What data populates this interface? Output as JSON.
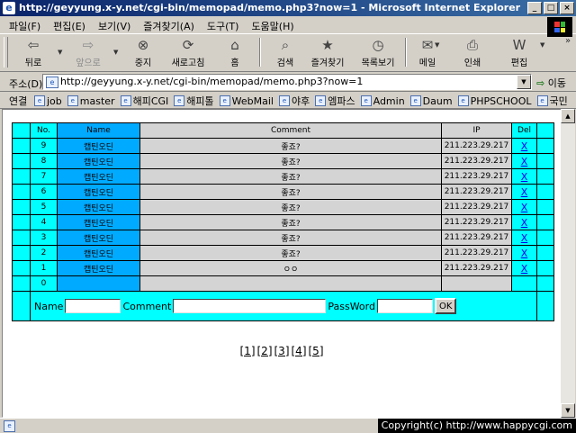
{
  "window": {
    "title": "http://geyyung.x-y.net/cgi-bin/memopad/memo.php3?now=1 - Microsoft Internet Explorer",
    "btn_min": "_",
    "btn_max": "□",
    "btn_close": "×"
  },
  "menu": [
    "파일(F)",
    "편집(E)",
    "보기(V)",
    "즐겨찾기(A)",
    "도구(T)",
    "도움말(H)"
  ],
  "toolbar": {
    "back": "뒤로",
    "forward": "앞으로",
    "stop": "중지",
    "refresh": "새로고침",
    "home": "홈",
    "search": "검색",
    "favorites": "즐겨찾기",
    "history": "목록보기",
    "mail": "메일",
    "print": "인쇄",
    "edit": "편집"
  },
  "address": {
    "label": "주소(D)",
    "url": "http://geyyung.x-y.net/cgi-bin/memopad/memo.php3?now=1",
    "go": "이동"
  },
  "links": {
    "label": "연결",
    "items": [
      "job",
      "master",
      "해피CGI",
      "해피톨",
      "WebMail",
      "야후",
      "엠파스",
      "Admin",
      "Daum",
      "PHPSCHOOL",
      "국민"
    ]
  },
  "memo": {
    "headers": {
      "no": "No.",
      "name": "Name",
      "comment": "Comment",
      "ip": "IP",
      "del": "Del"
    },
    "rows": [
      {
        "no": "9",
        "name": "캡틴오딘",
        "comment": "좋죠?",
        "ip": "211.223.29.217",
        "del": "X"
      },
      {
        "no": "8",
        "name": "캡틴오딘",
        "comment": "좋죠?",
        "ip": "211.223.29.217",
        "del": "X"
      },
      {
        "no": "7",
        "name": "캡틴오딘",
        "comment": "좋죠?",
        "ip": "211.223.29.217",
        "del": "X"
      },
      {
        "no": "6",
        "name": "캡틴오딘",
        "comment": "좋죠?",
        "ip": "211.223.29.217",
        "del": "X"
      },
      {
        "no": "5",
        "name": "캡틴오딘",
        "comment": "좋죠?",
        "ip": "211.223.29.217",
        "del": "X"
      },
      {
        "no": "4",
        "name": "캡틴오딘",
        "comment": "좋죠?",
        "ip": "211.223.29.217",
        "del": "X"
      },
      {
        "no": "3",
        "name": "캡틴오딘",
        "comment": "좋죠?",
        "ip": "211.223.29.217",
        "del": "X"
      },
      {
        "no": "2",
        "name": "캡틴오딘",
        "comment": "좋죠?",
        "ip": "211.223.29.217",
        "del": "X"
      },
      {
        "no": "1",
        "name": "캡틴오딘",
        "comment": "ㅇㅇ",
        "ip": "211.223.29.217",
        "del": "X"
      }
    ],
    "empty_row_no": "0",
    "form": {
      "name_label": "Name",
      "comment_label": "Comment",
      "password_label": "PassWord",
      "name_value": "",
      "comment_value": "",
      "password_value": "",
      "ok_label": "OK"
    }
  },
  "pager": [
    "[1]",
    "[2]",
    "[3]",
    "[4]",
    "[5]"
  ],
  "status": {
    "copyright": "Copyright(c) http://www.happycgi.com"
  },
  "colors": {
    "cyan": "#00ffff",
    "header_blue": "#00aaff",
    "cell_gray": "#d4d4d4",
    "link_blue": "#0000ee"
  }
}
